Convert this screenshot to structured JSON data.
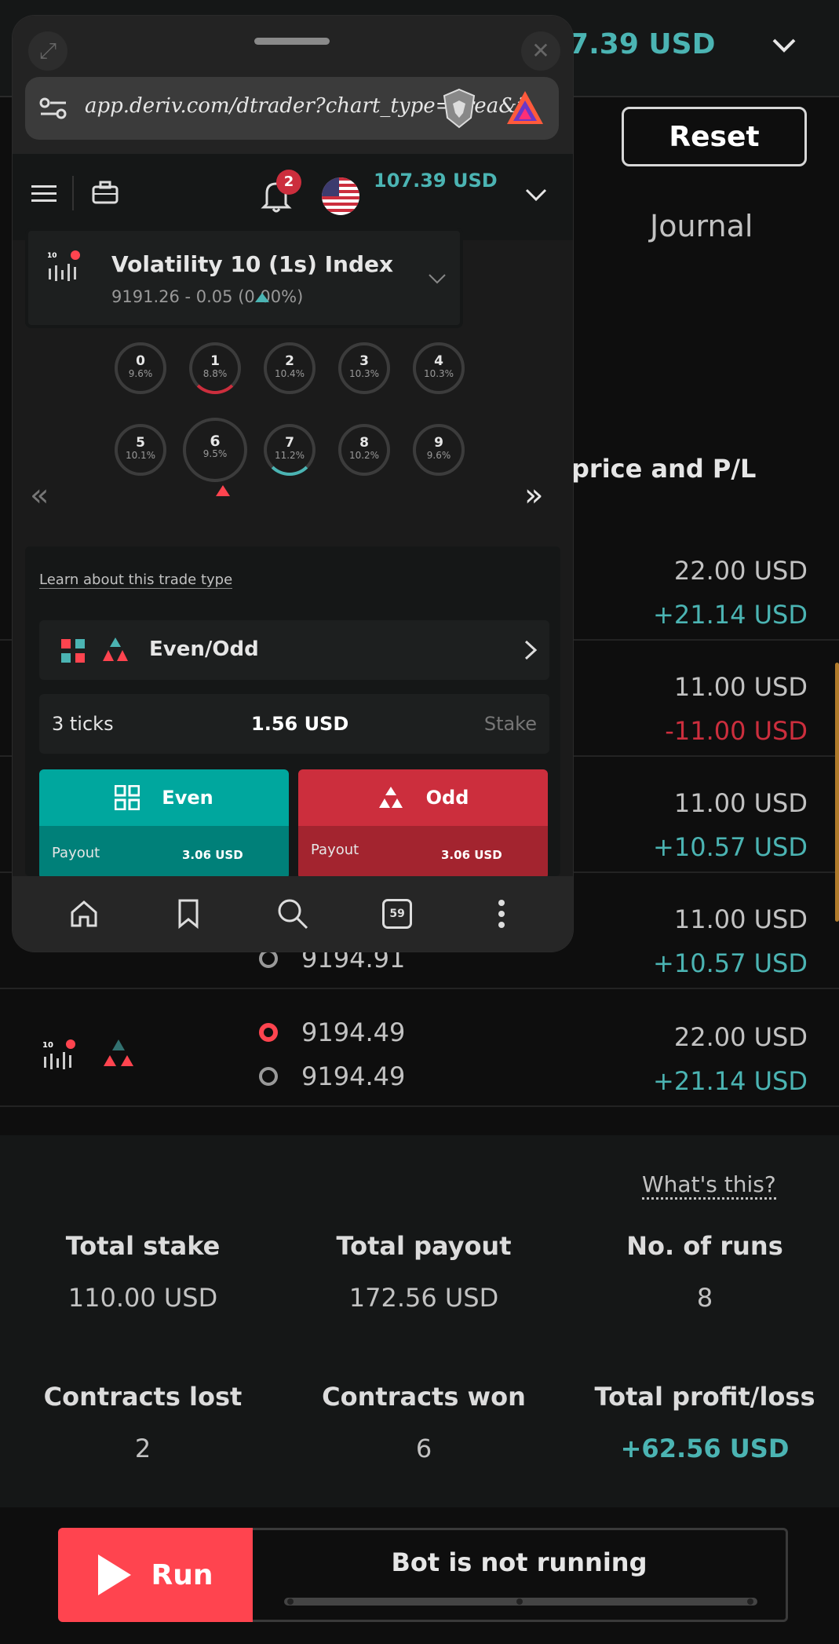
{
  "header": {
    "balance": "07.39 USD"
  },
  "reset_label": "Reset",
  "journal_tab": "Journal",
  "column_header": "price and P/L",
  "rows": [
    {
      "price": "22.00 USD",
      "pnl": "+21.14 USD",
      "pnl_type": "pos"
    },
    {
      "price": "11.00 USD",
      "pnl": "-11.00 USD",
      "pnl_type": "neg"
    },
    {
      "price": "11.00 USD",
      "pnl": "+10.57 USD",
      "pnl_type": "pos"
    },
    {
      "price": "11.00 USD",
      "pnl": "+10.57 USD",
      "pnl_type": "pos",
      "exit_tick": "9194.91"
    },
    {
      "price": "22.00 USD",
      "pnl": "+21.14 USD",
      "pnl_type": "pos",
      "entry_tick": "9194.49",
      "exit_tick": "9194.49"
    }
  ],
  "summary": {
    "whats_this": "What's this?",
    "total_stake_label": "Total stake",
    "total_stake": "110.00 USD",
    "total_payout_label": "Total payout",
    "total_payout": "172.56 USD",
    "runs_label": "No. of runs",
    "runs": "8",
    "lost_label": "Contracts lost",
    "lost": "2",
    "won_label": "Contracts won",
    "won": "6",
    "pl_label": "Total profit/loss",
    "pl": "+62.56 USD"
  },
  "run": {
    "button_label": "Run",
    "status": "Bot is not running"
  },
  "popup": {
    "url": "app.deriv.com/dtrader?chart_type=area&i",
    "notification_count": "2",
    "balance": "107.39 USD",
    "market_name": "Volatility 10 (1s) Index",
    "market_price": "9191.26 - 0.05 (0.00%)",
    "market_icon_label": "10",
    "digits": [
      {
        "n": "0",
        "p": "9.6%"
      },
      {
        "n": "1",
        "p": "8.8%"
      },
      {
        "n": "2",
        "p": "10.4%"
      },
      {
        "n": "3",
        "p": "10.3%"
      },
      {
        "n": "4",
        "p": "10.3%"
      },
      {
        "n": "5",
        "p": "10.1%"
      },
      {
        "n": "6",
        "p": "9.5%"
      },
      {
        "n": "7",
        "p": "11.2%"
      },
      {
        "n": "8",
        "p": "10.2%"
      },
      {
        "n": "9",
        "p": "9.6%"
      }
    ],
    "learn_link": "Learn about this trade type",
    "trade_type": "Even/Odd",
    "duration": "3 ticks",
    "stake_amount": "1.56 USD",
    "stake_label": "Stake",
    "even": {
      "label": "Even",
      "payout_label": "Payout",
      "payout": "3.06 USD"
    },
    "odd": {
      "label": "Odd",
      "payout_label": "Payout",
      "payout": "3.06 USD"
    },
    "tab_count": "59"
  },
  "colors": {
    "teal": "#4bb4b3",
    "red": "#ff444f",
    "loss": "#cc2e3d",
    "even": "#00a79e",
    "odd": "#cc2e3d"
  }
}
